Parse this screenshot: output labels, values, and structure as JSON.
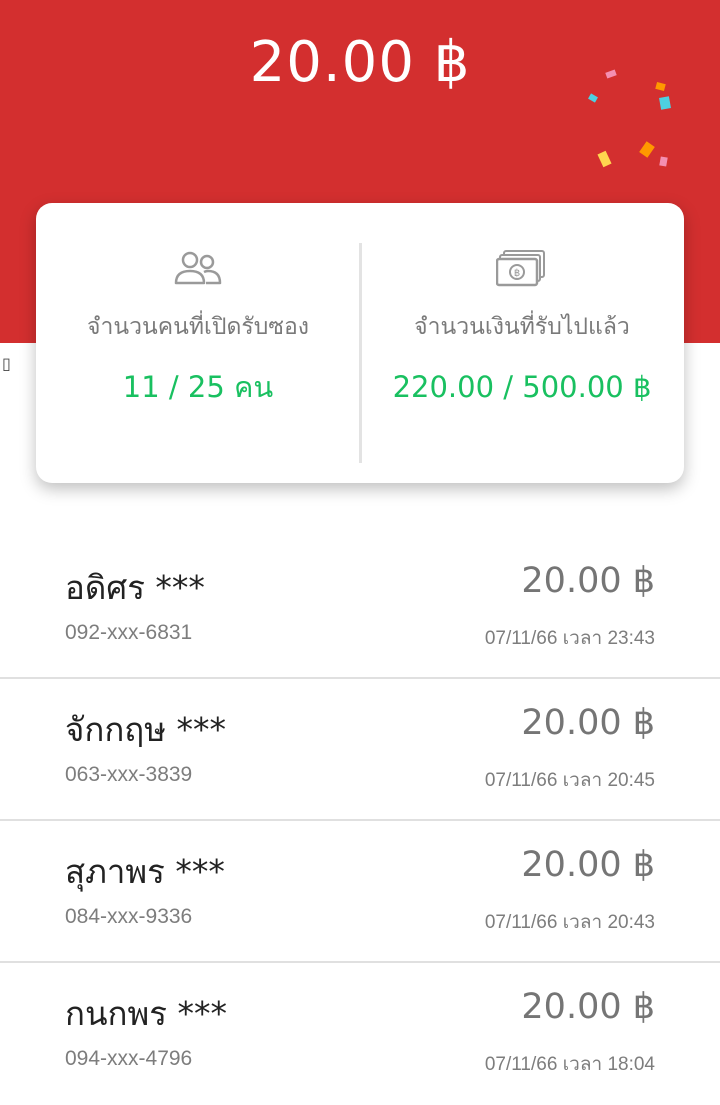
{
  "header": {
    "amount": "20.00 ฿"
  },
  "side_glyph": "▯",
  "summary": {
    "people": {
      "icon": "people-icon",
      "label": "จำนวนคนที่เปิดรับซอง",
      "value": "11 / 25 คน"
    },
    "money": {
      "icon": "banknote-icon",
      "label": "จำนวนเงินที่รับไปแล้ว",
      "value": "220.00 / 500.00 ฿"
    }
  },
  "recipients": [
    {
      "name": "อดิศร ***",
      "phone": "092-xxx-6831",
      "amount": "20.00 ฿",
      "time": "07/11/66 เวลา 23:43"
    },
    {
      "name": "จักกฤษ ***",
      "phone": "063-xxx-3839",
      "amount": "20.00 ฿",
      "time": "07/11/66 เวลา 20:45"
    },
    {
      "name": "สุภาพร ***",
      "phone": "084-xxx-9336",
      "amount": "20.00 ฿",
      "time": "07/11/66 เวลา 20:43"
    },
    {
      "name": "กนกพร ***",
      "phone": "094-xxx-4796",
      "amount": "20.00 ฿",
      "time": "07/11/66 เวลา 18:04"
    }
  ],
  "colors": {
    "header_bg": "#d32f2f",
    "accent_green": "#19c060",
    "muted_text": "#7a7a7a"
  }
}
